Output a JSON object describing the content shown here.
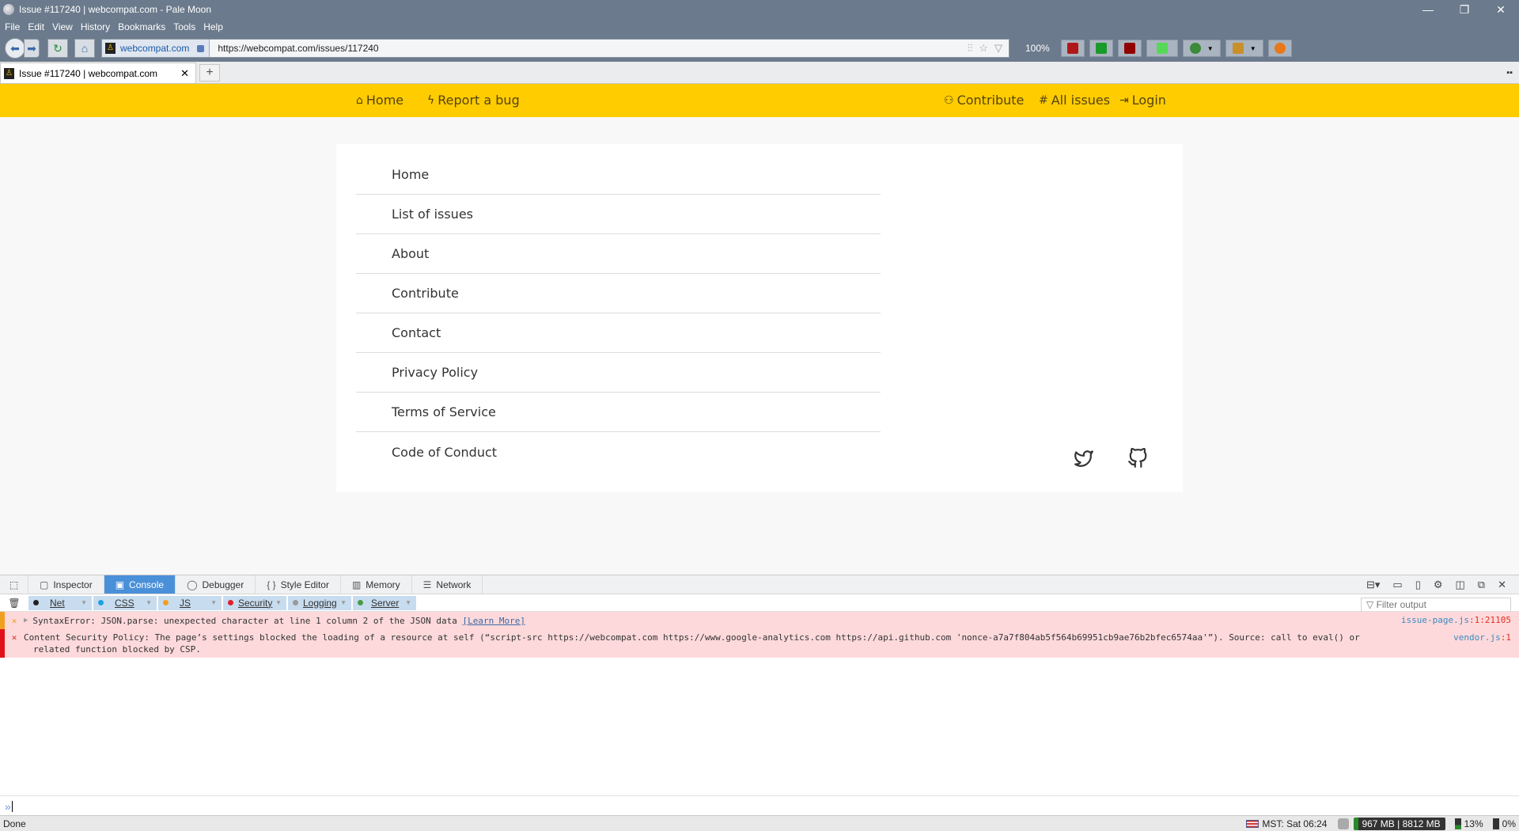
{
  "window": {
    "title": "Issue #117240 | webcompat.com - Pale Moon",
    "controls": {
      "minimize": "—",
      "restore": "❐",
      "close": "✕"
    }
  },
  "menubar": [
    "File",
    "Edit",
    "View",
    "History",
    "Bookmarks",
    "Tools",
    "Help"
  ],
  "navbar": {
    "identity_label": "webcompat.com",
    "url": "https://webcompat.com/issues/117240",
    "zoom": "100%",
    "extensions": [
      {
        "name": "extension-red-icon",
        "color": "#b01818"
      },
      {
        "name": "extension-green-shield-icon",
        "color": "#1a9a2a"
      },
      {
        "name": "ublock-origin-icon",
        "color": "#900000"
      },
      {
        "name": "extension-green-grid-icon",
        "color": "#58d858"
      },
      {
        "name": "extension-chain-icon",
        "color": "#3a8a3a"
      },
      {
        "name": "extension-box-icon",
        "color": "#c8902a"
      },
      {
        "name": "extension-orange-icon",
        "color": "#e87818"
      }
    ]
  },
  "tabs": [
    {
      "title": "Issue #117240 | webcompat.com",
      "active": true
    }
  ],
  "site": {
    "accent": "#ffcc00",
    "nav_left": [
      {
        "icon": "home-icon",
        "label": "Home"
      },
      {
        "icon": "lightning-icon",
        "label": "Report a bug"
      }
    ],
    "nav_right": [
      {
        "icon": "users-icon",
        "label": "Contribute"
      },
      {
        "icon": "hash-icon",
        "label": "All issues"
      },
      {
        "icon": "login-icon",
        "label": "Login"
      }
    ],
    "footer_menu": [
      "Home",
      "List of issues",
      "About",
      "Contribute",
      "Contact",
      "Privacy Policy",
      "Terms of Service",
      "Code of Conduct"
    ],
    "social": [
      "twitter-icon",
      "github-icon"
    ]
  },
  "devtools": {
    "tabs": [
      {
        "label": "Inspector",
        "icon": "▢"
      },
      {
        "label": "Console",
        "icon": "▣",
        "active": true
      },
      {
        "label": "Debugger",
        "icon": "◯"
      },
      {
        "label": "Style Editor",
        "icon": "{ }"
      },
      {
        "label": "Memory",
        "icon": "▥"
      },
      {
        "label": "Network",
        "icon": "☰"
      }
    ],
    "filters": [
      {
        "label": "Net",
        "color": "#222222"
      },
      {
        "label": "CSS",
        "color": "#1ea0e0"
      },
      {
        "label": "JS",
        "color": "#f0a020"
      },
      {
        "label": "Security",
        "color": "#e02030"
      },
      {
        "label": "Logging",
        "color": "#999999"
      },
      {
        "label": "Server",
        "color": "#4a9a4a"
      }
    ],
    "filter_placeholder": "Filter output",
    "messages": [
      {
        "type": "warning",
        "text": "SyntaxError: JSON.parse: unexpected character at line 1 column 2 of the JSON data",
        "link": "[Learn More]",
        "source_file": "issue-page.js",
        "source_loc": ":1:21105"
      },
      {
        "type": "error",
        "text": "Content Security Policy: The page’s settings blocked the loading of a resource at self (“script-src https://webcompat.com https://www.google-analytics.com https://api.github.com 'nonce-a7a7f804ab5f564b69951cb9ae76b2bfec6574aa'”). Source: call to eval() or",
        "text_line2": "related function blocked by CSP.",
        "source_file": "vendor.js",
        "source_loc": ":1"
      }
    ],
    "prompt": "»"
  },
  "statusbar": {
    "status": "Done",
    "clock": "MST: Sat 06:24",
    "memory": "967 MB | 8812 MB",
    "cpu": "13%",
    "other": "0%"
  }
}
